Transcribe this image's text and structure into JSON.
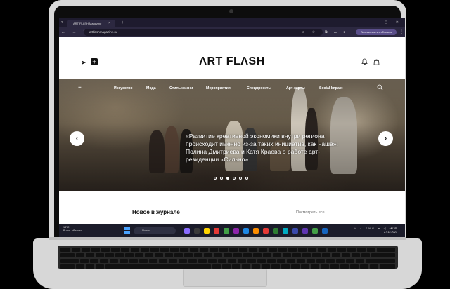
{
  "browser": {
    "tab_title": "ART FLASH Magazine",
    "tab_close": "×",
    "new_tab": "+",
    "nav_buttons": "← → ↻",
    "url": "artflashmagazine.ru",
    "omnibox_icons": "⌕ ☆",
    "extension_icons": "⧉ ▭ ●",
    "update_button": "Перезапустить и обновить",
    "menu": "⋮",
    "window_controls": "– ▢ ✕",
    "tab_menu": "▾"
  },
  "site": {
    "logo": "ΛRT FLΛSH",
    "telegram_icon": "➤",
    "plus_icon": "+",
    "bell_icon": "🔔",
    "bag_icon": "👜",
    "hamburger_icon": "≡",
    "search_icon": "○",
    "nav": [
      "Искусство",
      "Мода",
      "Стиль жизни",
      "Мероприятия",
      "Спецпроекты",
      "Арт-карты",
      "Social Impact"
    ],
    "hero": {
      "headline": "«Развитие креативной экономики внутри региона происходит именно из-за таких инициатив, как наша»: Полина Дмитриева и Катя Краева о работе арт-резиденции «Сильно»",
      "prev_arrow": "‹",
      "next_arrow": "›",
      "slides_total": 6,
      "active_slide": 3
    },
    "section_title": "Новое в журнале",
    "see_all": "Посмотреть все"
  },
  "taskbar": {
    "weather_temp": "13°C",
    "weather_text": "В осн. облачно",
    "search_placeholder": "Поиск",
    "tray": "^ ☁ ENG ᯤ ◁ ▭",
    "time": "17:30",
    "date": "27.12.2023"
  },
  "colors": {
    "browser_dark": "#1e1b2e",
    "update_accent": "#5a4e8a",
    "taskbar": "#1b1c2a"
  }
}
